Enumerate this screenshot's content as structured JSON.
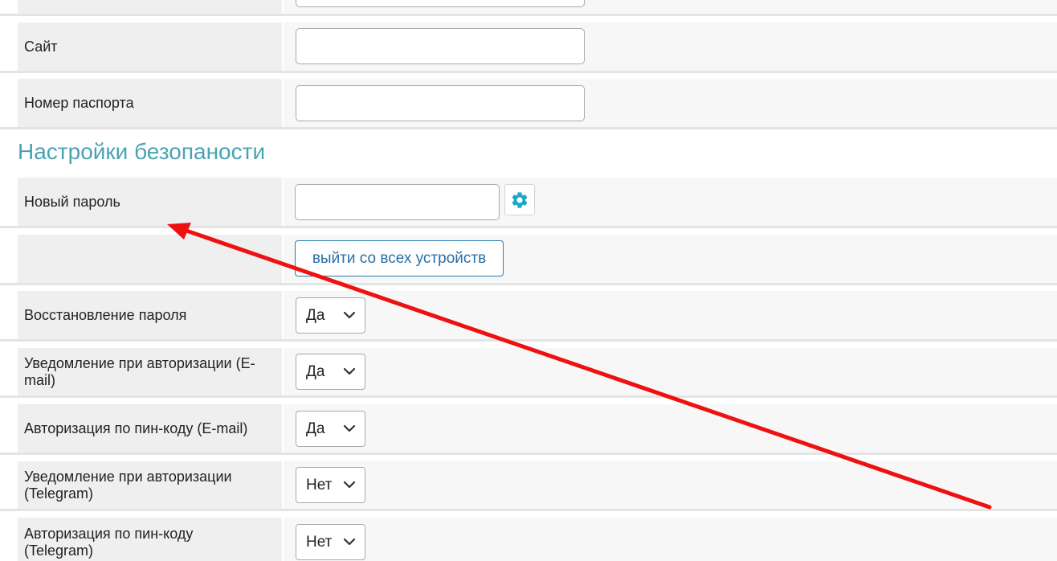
{
  "contact_fields": [
    {
      "label": "Сайт",
      "value": ""
    },
    {
      "label": "Номер паспорта",
      "value": ""
    }
  ],
  "security": {
    "title": "Настройки безопаности",
    "new_password": {
      "label": "Новый пароль",
      "value": ""
    },
    "generate_icon": "gear-icon",
    "logout_all_label": "выйти со всех устройств",
    "selects": [
      {
        "label": "Восстановление пароля",
        "value": "Да"
      },
      {
        "label": "Уведомление при авторизации (E-mail)",
        "value": "Да"
      },
      {
        "label": "Авторизация по пин-коду (E-mail)",
        "value": "Да"
      },
      {
        "label": "Уведомление при авторизации (Telegram)",
        "value": "Нет"
      },
      {
        "label": "Авторизация по пин-коду (Telegram)",
        "value": "Нет"
      }
    ]
  },
  "colors": {
    "section_title": "#4aa3b3",
    "accent_button": "#2a7ab0",
    "gear_icon": "#1aa8c4",
    "annotation_arrow": "#ee1111"
  }
}
